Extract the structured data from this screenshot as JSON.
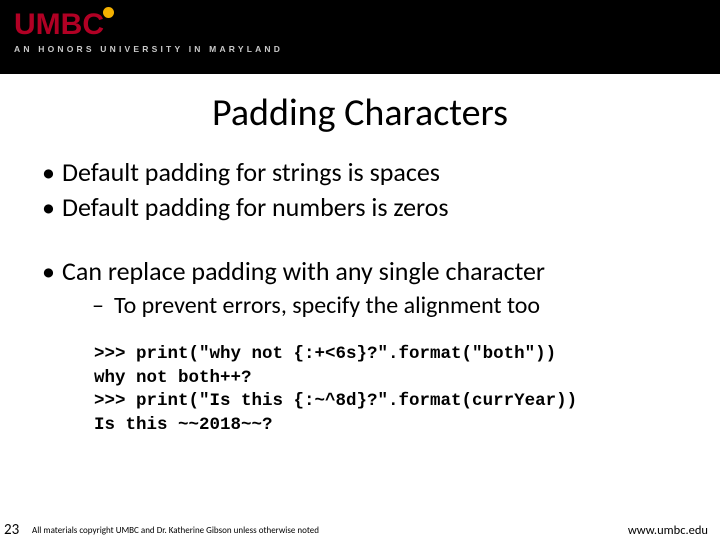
{
  "header": {
    "logo_text": "UMBC",
    "tagline": "AN HONORS UNIVERSITY IN MARYLAND"
  },
  "title": "Padding Characters",
  "bullets": {
    "b1": "Default padding for strings is spaces",
    "b2": "Default padding for numbers is zeros",
    "b3": "Can replace padding with any single character",
    "b3_sub": "To prevent errors, specify the alignment too"
  },
  "code_lines": {
    "l1": ">>> print(\"why not {:+<6s}?\".format(\"both\"))",
    "l2": "why not both++?",
    "l3": ">>> print(\"Is this {:~^8d}?\".format(currYear))",
    "l4": "Is this ~~2018~~?"
  },
  "footer": {
    "page": "23",
    "copyright": "All materials copyright UMBC and Dr. Katherine Gibson unless otherwise noted",
    "url": "www.umbc.edu"
  }
}
